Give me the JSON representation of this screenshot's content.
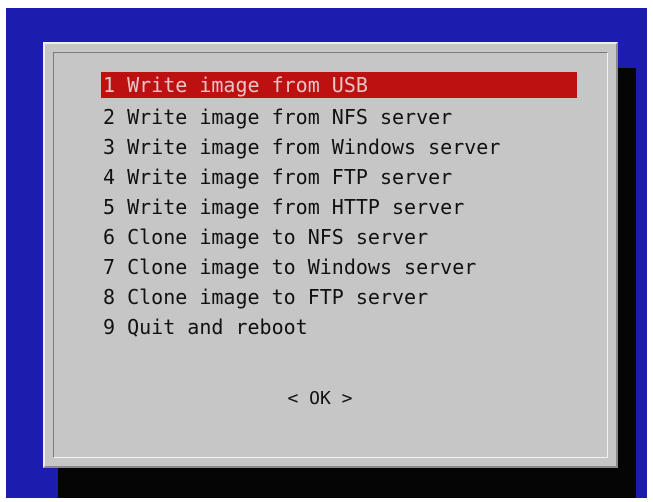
{
  "menu": {
    "items": [
      {
        "number": "1",
        "label": "1 Write image from USB",
        "selected": true
      },
      {
        "number": "2",
        "label": "2 Write image from NFS server",
        "selected": false
      },
      {
        "number": "3",
        "label": "3 Write image from Windows server",
        "selected": false
      },
      {
        "number": "4",
        "label": "4 Write image from FTP server",
        "selected": false
      },
      {
        "number": "5",
        "label": "5 Write image from HTTP server",
        "selected": false
      },
      {
        "number": "6",
        "label": "6 Clone image to NFS server",
        "selected": false
      },
      {
        "number": "7",
        "label": "7 Clone image to Windows server",
        "selected": false
      },
      {
        "number": "8",
        "label": "8 Clone image to FTP server",
        "selected": false
      },
      {
        "number": "9",
        "label": "9 Quit and reboot",
        "selected": false
      }
    ]
  },
  "buttons": {
    "ok_label": "< OK >"
  },
  "colors": {
    "background": "#1c1cae",
    "dialog": "#c6c6c6",
    "highlight": "#bd1010",
    "shadow": "#050505"
  }
}
